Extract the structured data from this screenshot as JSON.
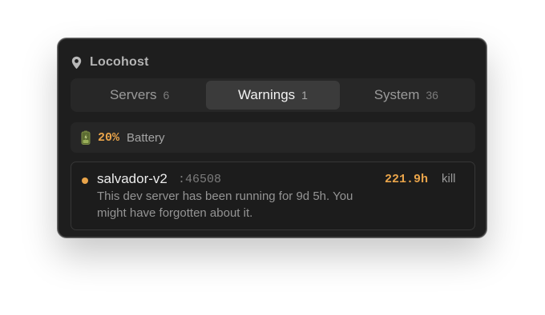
{
  "app": {
    "title": "Locohost"
  },
  "tabs": [
    {
      "label": "Servers",
      "count": "6",
      "active": false
    },
    {
      "label": "Warnings",
      "count": "1",
      "active": true
    },
    {
      "label": "System",
      "count": "36",
      "active": false
    }
  ],
  "battery": {
    "percent": "20%",
    "label": "Battery",
    "icon": "battery-icon"
  },
  "warning": {
    "name": "salvador-v2",
    "port": ":46508",
    "description": "This dev server has been running for 9d 5h. You might have forgotten about it.",
    "uptime": "221.9h",
    "action_label": "kill",
    "status_color": "#e9a44a"
  },
  "colors": {
    "accent": "#e9a44a",
    "background": "#1e1e1e"
  }
}
